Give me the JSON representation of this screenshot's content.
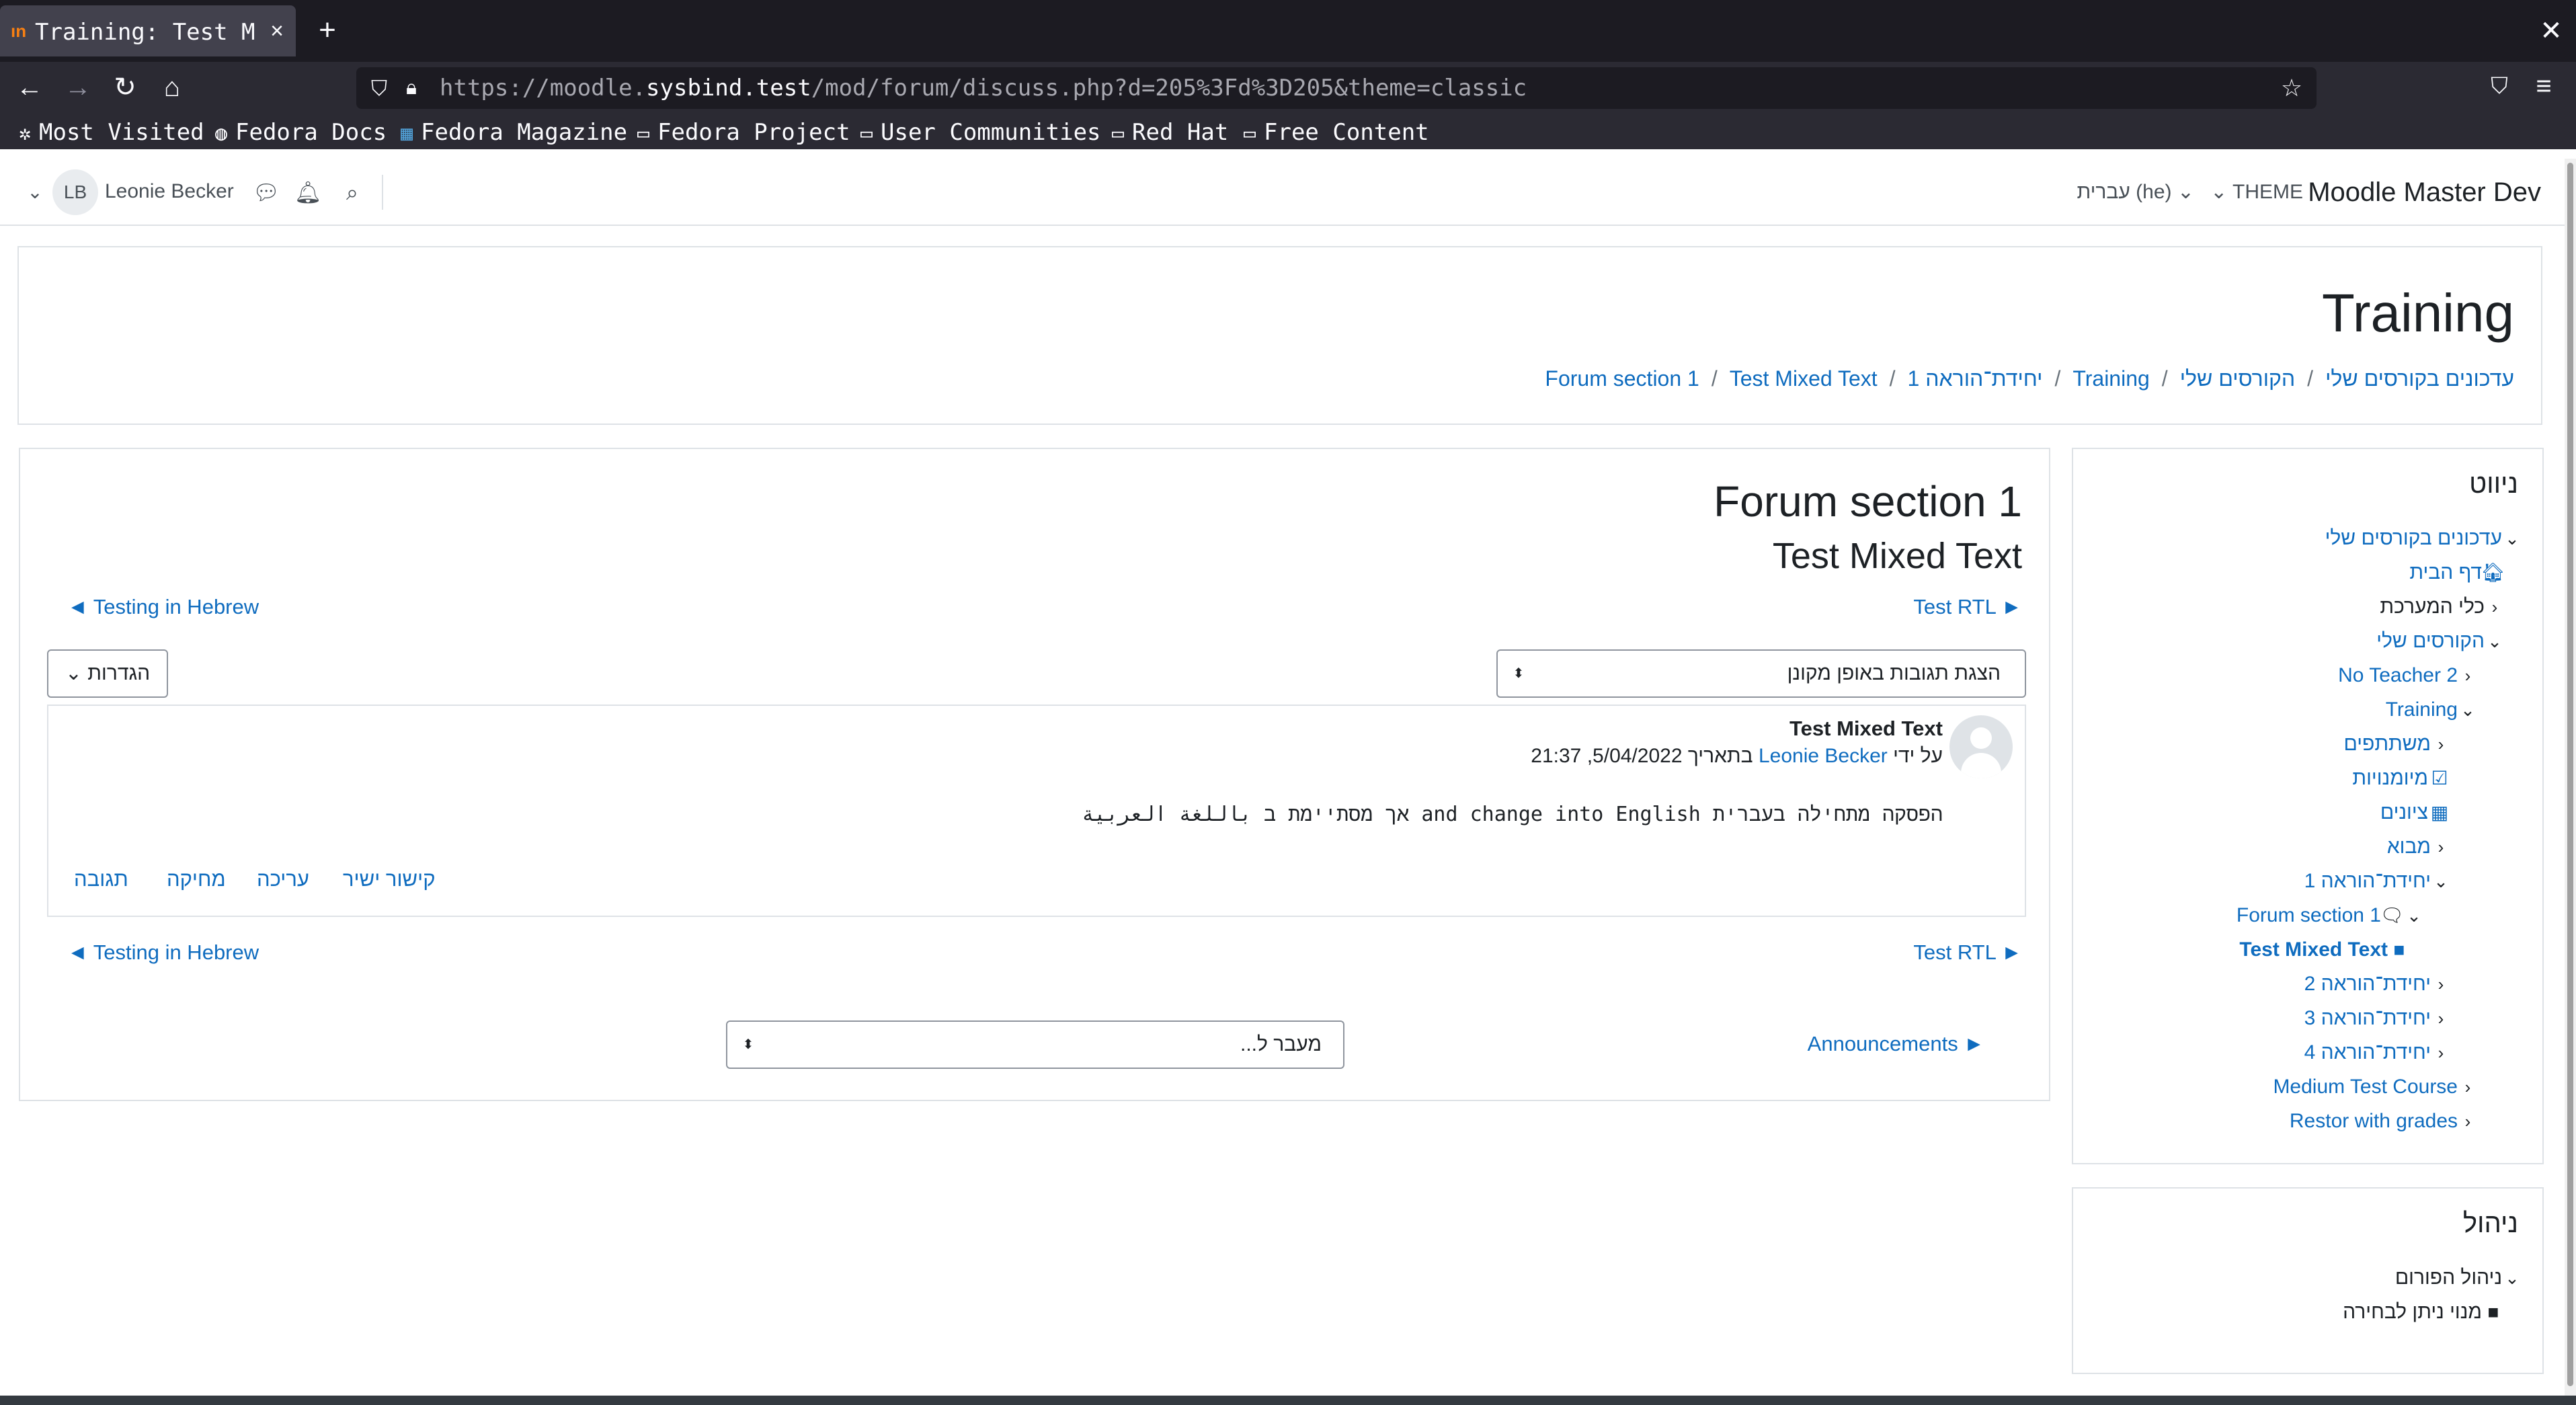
{
  "browser": {
    "tab_title": "Training: Test Mixed Text",
    "tab_favicon": "ın",
    "url_prefix": "https://moodle.",
    "url_domain": "sysbind.test",
    "url_path": "/mod/forum/discuss.php?d=205%3Fd%3D205&theme=classic",
    "bookmarks": [
      "Most Visited",
      "Fedora Docs",
      "Fedora Magazine",
      "Fedora Project",
      "User Communities",
      "Red Hat",
      "Free Content"
    ]
  },
  "header": {
    "user_initials": "LB",
    "user_name": "Leonie Becker",
    "site_name": "Moodle Master Dev",
    "theme_label": "THEME",
    "language_label": "עברית (he)"
  },
  "page": {
    "title": "Training",
    "breadcrumb": [
      "עדכונים בקורסים שלי",
      "הקורסים שלי",
      "Training",
      "יחידת־הוראה 1",
      "Forum section 1",
      "Test Mixed Text"
    ]
  },
  "main": {
    "forum_title": "Forum section 1",
    "discussion_title": "Test Mixed Text",
    "next_link": "Test RTL ►",
    "prev_link": "◄ Testing in Hebrew",
    "display_mode": "הצגת תגובות באופן מקונן",
    "settings_label": "הגדרות",
    "post": {
      "subject": "Test Mixed Text",
      "by_prefix": "על ידי",
      "author": "Leonie Becker",
      "date_text": "בתאריך 5/04/2022, 21:37",
      "body": "הפסקה מתחילה בעברית and change into English אך מסתיימת ב باللغة العربية",
      "commands": [
        "קישור ישיר",
        "עריכה",
        "מחיקה",
        "תגובה"
      ]
    },
    "jump_to": "מעבר ל...",
    "announcements_link": "Announcements ►"
  },
  "navigation_block": {
    "title": "ניווט",
    "items": [
      {
        "label": "עדכונים בקורסים שלי",
        "caret": "⌄",
        "icon": ""
      },
      {
        "label": "דף הבית",
        "caret": "",
        "icon": "home-icon"
      },
      {
        "label": "כלי המערכת",
        "caret": "‹",
        "icon": ""
      },
      {
        "label": "הקורסים שלי",
        "caret": "⌄",
        "icon": ""
      },
      {
        "label": "No Teacher 2",
        "caret": "‹",
        "icon": ""
      },
      {
        "label": "Training",
        "caret": "⌄",
        "icon": ""
      },
      {
        "label": "משתתפים",
        "caret": "‹",
        "icon": ""
      },
      {
        "label": "מיומנויות",
        "caret": "",
        "icon": "checkbox-icon"
      },
      {
        "label": "ציונים",
        "caret": "",
        "icon": "table-icon"
      },
      {
        "label": "מבוא",
        "caret": "‹",
        "icon": ""
      },
      {
        "label": "יחידת־הוראה 1",
        "caret": "⌄",
        "icon": ""
      },
      {
        "label": "Forum section 1",
        "caret": "⌄",
        "icon": "forum-icon"
      },
      {
        "label": "Test Mixed Text",
        "caret": "",
        "icon": "square-icon"
      },
      {
        "label": "יחידת־הוראה 2",
        "caret": "‹",
        "icon": ""
      },
      {
        "label": "יחידת־הוראה 3",
        "caret": "‹",
        "icon": ""
      },
      {
        "label": "יחידת־הוראה 4",
        "caret": "‹",
        "icon": ""
      },
      {
        "label": "Medium Test Course",
        "caret": "‹",
        "icon": ""
      },
      {
        "label": "Restor with grades",
        "caret": "‹",
        "icon": ""
      }
    ]
  },
  "admin_block": {
    "title": "ניהול",
    "items": [
      {
        "label": "ניהול הפורום",
        "caret": "⌄"
      },
      {
        "label": "מנוי ניתן לבחירה",
        "caret": ""
      }
    ]
  },
  "colors": {
    "link": "#0f6cbf",
    "browser_dark": "#1c1b22",
    "border": "#dee2e6"
  }
}
